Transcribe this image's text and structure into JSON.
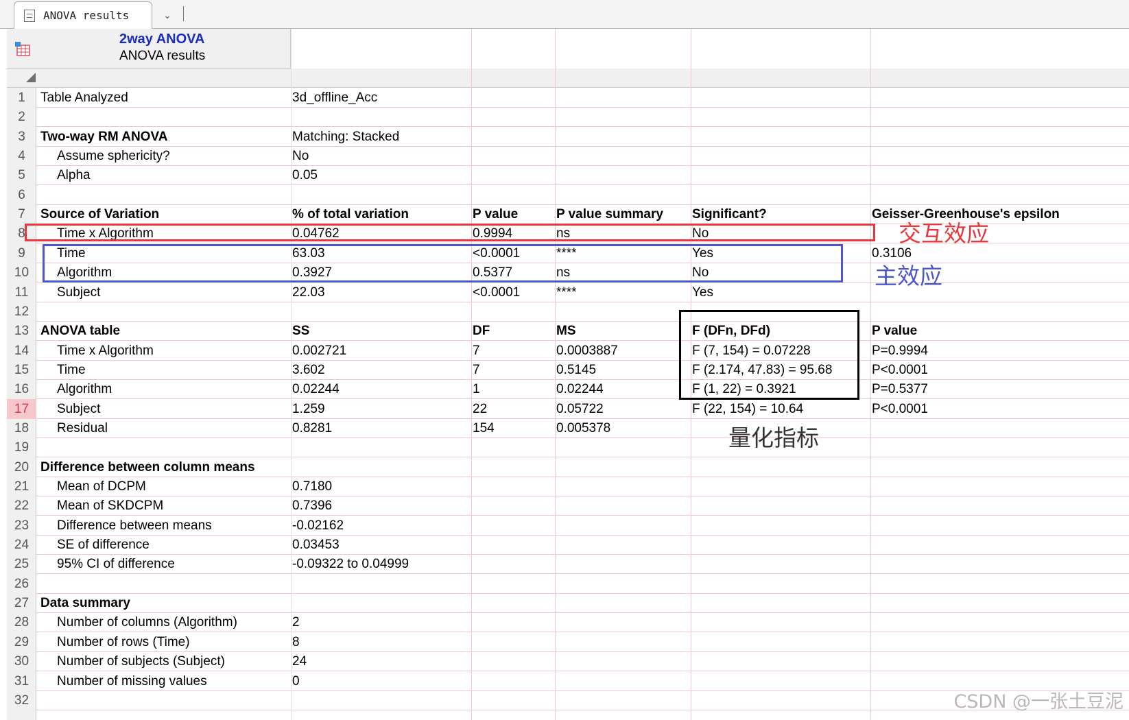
{
  "tab": {
    "label": "ANOVA results",
    "icon": "sheet-icon"
  },
  "header": {
    "title": "2way ANOVA",
    "subtitle": "ANOVA results",
    "title_color": "#1b2cc1"
  },
  "rows": [
    {
      "n": "1",
      "cells": [
        "Table Analyzed",
        "3d_offline_Acc",
        "",
        "",
        "",
        ""
      ],
      "bold": false,
      "indent": false
    },
    {
      "n": "2",
      "cells": [
        "",
        "",
        "",
        "",
        "",
        ""
      ],
      "bold": false,
      "indent": false
    },
    {
      "n": "3",
      "cells": [
        "Two-way RM ANOVA",
        "Matching: Stacked",
        "",
        "",
        "",
        ""
      ],
      "bold": false,
      "boldFirst": true,
      "indent": false
    },
    {
      "n": "4",
      "cells": [
        "Assume sphericity?",
        "No",
        "",
        "",
        "",
        ""
      ],
      "bold": false,
      "indent": true
    },
    {
      "n": "5",
      "cells": [
        "Alpha",
        "0.05",
        "",
        "",
        "",
        ""
      ],
      "bold": false,
      "indent": true
    },
    {
      "n": "6",
      "cells": [
        "",
        "",
        "",
        "",
        "",
        ""
      ],
      "bold": false,
      "indent": false
    },
    {
      "n": "7",
      "cells": [
        "Source of Variation",
        "% of total variation",
        "P value",
        "P value summary",
        "Significant?",
        "Geisser-Greenhouse's epsilon"
      ],
      "bold": true,
      "indent": false
    },
    {
      "n": "8",
      "cells": [
        "Time x Algorithm",
        "0.04762",
        "0.9994",
        "ns",
        "No",
        ""
      ],
      "bold": false,
      "indent": true
    },
    {
      "n": "9",
      "cells": [
        "Time",
        "63.03",
        "<0.0001",
        "****",
        "Yes",
        "0.3106"
      ],
      "bold": false,
      "indent": true
    },
    {
      "n": "10",
      "cells": [
        "Algorithm",
        "0.3927",
        "0.5377",
        "ns",
        "No",
        ""
      ],
      "bold": false,
      "indent": true
    },
    {
      "n": "11",
      "cells": [
        "Subject",
        "22.03",
        "<0.0001",
        "****",
        "Yes",
        ""
      ],
      "bold": false,
      "indent": true
    },
    {
      "n": "12",
      "cells": [
        "",
        "",
        "",
        "",
        "",
        ""
      ],
      "bold": false,
      "indent": false
    },
    {
      "n": "13",
      "cells": [
        "ANOVA table",
        "SS",
        "DF",
        "MS",
        "F (DFn, DFd)",
        "P value"
      ],
      "bold": true,
      "indent": false
    },
    {
      "n": "14",
      "cells": [
        "Time x Algorithm",
        "0.002721",
        "7",
        "0.0003887",
        "F (7, 154) = 0.07228",
        "P=0.9994"
      ],
      "bold": false,
      "indent": true
    },
    {
      "n": "15",
      "cells": [
        "Time",
        "3.602",
        "7",
        "0.5145",
        "F (2.174, 47.83) = 95.68",
        "P<0.0001"
      ],
      "bold": false,
      "indent": true
    },
    {
      "n": "16",
      "cells": [
        "Algorithm",
        "0.02244",
        "1",
        "0.02244",
        "F (1, 22) = 0.3921",
        "P=0.5377"
      ],
      "bold": false,
      "indent": true
    },
    {
      "n": "17",
      "cells": [
        "Subject",
        "1.259",
        "22",
        "0.05722",
        "F (22, 154) = 10.64",
        "P<0.0001"
      ],
      "bold": false,
      "indent": true,
      "selected": true
    },
    {
      "n": "18",
      "cells": [
        "Residual",
        "0.8281",
        "154",
        "0.005378",
        "",
        ""
      ],
      "bold": false,
      "indent": true
    },
    {
      "n": "19",
      "cells": [
        "",
        "",
        "",
        "",
        "",
        ""
      ],
      "bold": false,
      "indent": false
    },
    {
      "n": "20",
      "cells": [
        "Difference between column means",
        "",
        "",
        "",
        "",
        ""
      ],
      "bold": true,
      "indent": false
    },
    {
      "n": "21",
      "cells": [
        "Mean of DCPM",
        "0.7180",
        "",
        "",
        "",
        ""
      ],
      "bold": false,
      "indent": true
    },
    {
      "n": "22",
      "cells": [
        "Mean of SKDCPM",
        "0.7396",
        "",
        "",
        "",
        ""
      ],
      "bold": false,
      "indent": true
    },
    {
      "n": "23",
      "cells": [
        "Difference between means",
        "-0.02162",
        "",
        "",
        "",
        ""
      ],
      "bold": false,
      "indent": true
    },
    {
      "n": "24",
      "cells": [
        "SE of difference",
        "0.03453",
        "",
        "",
        "",
        ""
      ],
      "bold": false,
      "indent": true
    },
    {
      "n": "25",
      "cells": [
        "95% CI of difference",
        "-0.09322 to 0.04999",
        "",
        "",
        "",
        ""
      ],
      "bold": false,
      "indent": true
    },
    {
      "n": "26",
      "cells": [
        "",
        "",
        "",
        "",
        "",
        ""
      ],
      "bold": false,
      "indent": false
    },
    {
      "n": "27",
      "cells": [
        "Data summary",
        "",
        "",
        "",
        "",
        ""
      ],
      "bold": true,
      "indent": false
    },
    {
      "n": "28",
      "cells": [
        "Number of columns (Algorithm)",
        "2",
        "",
        "",
        "",
        ""
      ],
      "bold": false,
      "indent": true
    },
    {
      "n": "29",
      "cells": [
        "Number of rows (Time)",
        "8",
        "",
        "",
        "",
        ""
      ],
      "bold": false,
      "indent": true
    },
    {
      "n": "30",
      "cells": [
        "Number of subjects (Subject)",
        "24",
        "",
        "",
        "",
        ""
      ],
      "bold": false,
      "indent": true
    },
    {
      "n": "31",
      "cells": [
        "Number of missing values",
        "0",
        "",
        "",
        "",
        ""
      ],
      "bold": false,
      "indent": true
    },
    {
      "n": "32",
      "cells": [
        "",
        "",
        "",
        "",
        "",
        ""
      ],
      "bold": false,
      "indent": false
    }
  ],
  "annotations": {
    "interaction": {
      "text": "交互效应",
      "color": "#e8373c"
    },
    "main_effect": {
      "text": "主效应",
      "color": "#4a56c9"
    },
    "metrics": {
      "text": "量化指标",
      "color": "#333333"
    }
  },
  "watermark": "CSDN @一张土豆泥",
  "colors": {
    "grid_line": "#f0c9cf",
    "header_bg": "#f0f0f0",
    "selected_row_bg": "#f6c7cd"
  }
}
